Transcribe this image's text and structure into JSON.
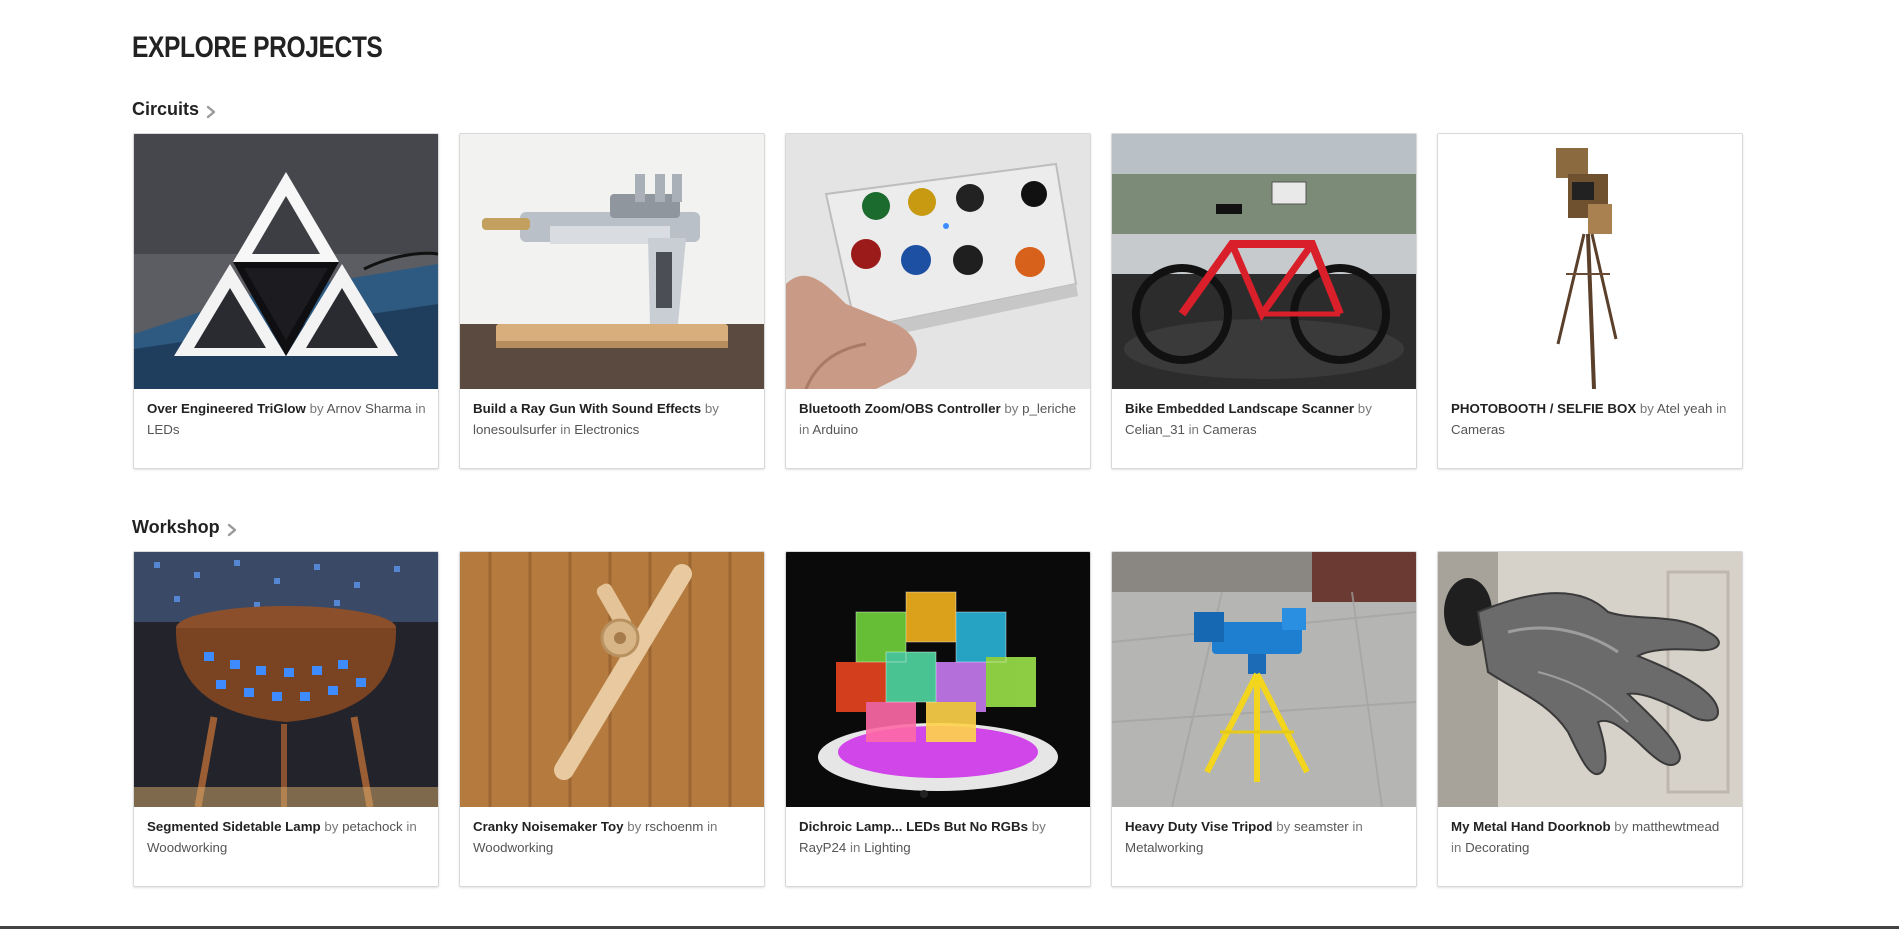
{
  "page": {
    "title": "EXPLORE PROJECTS"
  },
  "sections": [
    {
      "heading": "Circuits",
      "cards": [
        {
          "title": "Over Engineered TriGlow",
          "by": "by",
          "author": "Arnov Sharma",
          "in": "in",
          "category": "LEDs"
        },
        {
          "title": "Build a Ray Gun With Sound Effects",
          "by": "by",
          "author": "lonesoulsurfer",
          "in": "in",
          "category": "Electronics"
        },
        {
          "title": "Bluetooth Zoom/OBS Controller",
          "by": "by",
          "author": "p_leriche",
          "in": "in",
          "category": "Arduino"
        },
        {
          "title": "Bike Embedded Landscape Scanner",
          "by": "by",
          "author": "Celian_31",
          "in": "in",
          "category": "Cameras"
        },
        {
          "title": "PHOTOBOOTH / SELFIE BOX",
          "by": "by",
          "author": "Atel yeah",
          "in": "in",
          "category": "Cameras"
        }
      ]
    },
    {
      "heading": "Workshop",
      "cards": [
        {
          "title": "Segmented Sidetable Lamp",
          "by": "by",
          "author": "petachock",
          "in": "in",
          "category": "Woodworking"
        },
        {
          "title": "Cranky Noisemaker Toy",
          "by": "by",
          "author": "rschoenm",
          "in": "in",
          "category": "Woodworking"
        },
        {
          "title": "Dichroic Lamp... LEDs But No RGBs",
          "by": "by",
          "author": "RayP24",
          "in": "in",
          "category": "Lighting"
        },
        {
          "title": "Heavy Duty Vise Tripod",
          "by": "by",
          "author": "seamster",
          "in": "in",
          "category": "Metalworking"
        },
        {
          "title": "My Metal Hand Doorknob",
          "by": "by",
          "author": "matthewtmead",
          "in": "in",
          "category": "Decorating"
        }
      ]
    }
  ],
  "icons": {
    "section_arrow": "chevron-right-icon"
  },
  "colors": {
    "text_dark": "#222222",
    "text_muted": "#777777",
    "card_border": "#d9d9d9"
  }
}
